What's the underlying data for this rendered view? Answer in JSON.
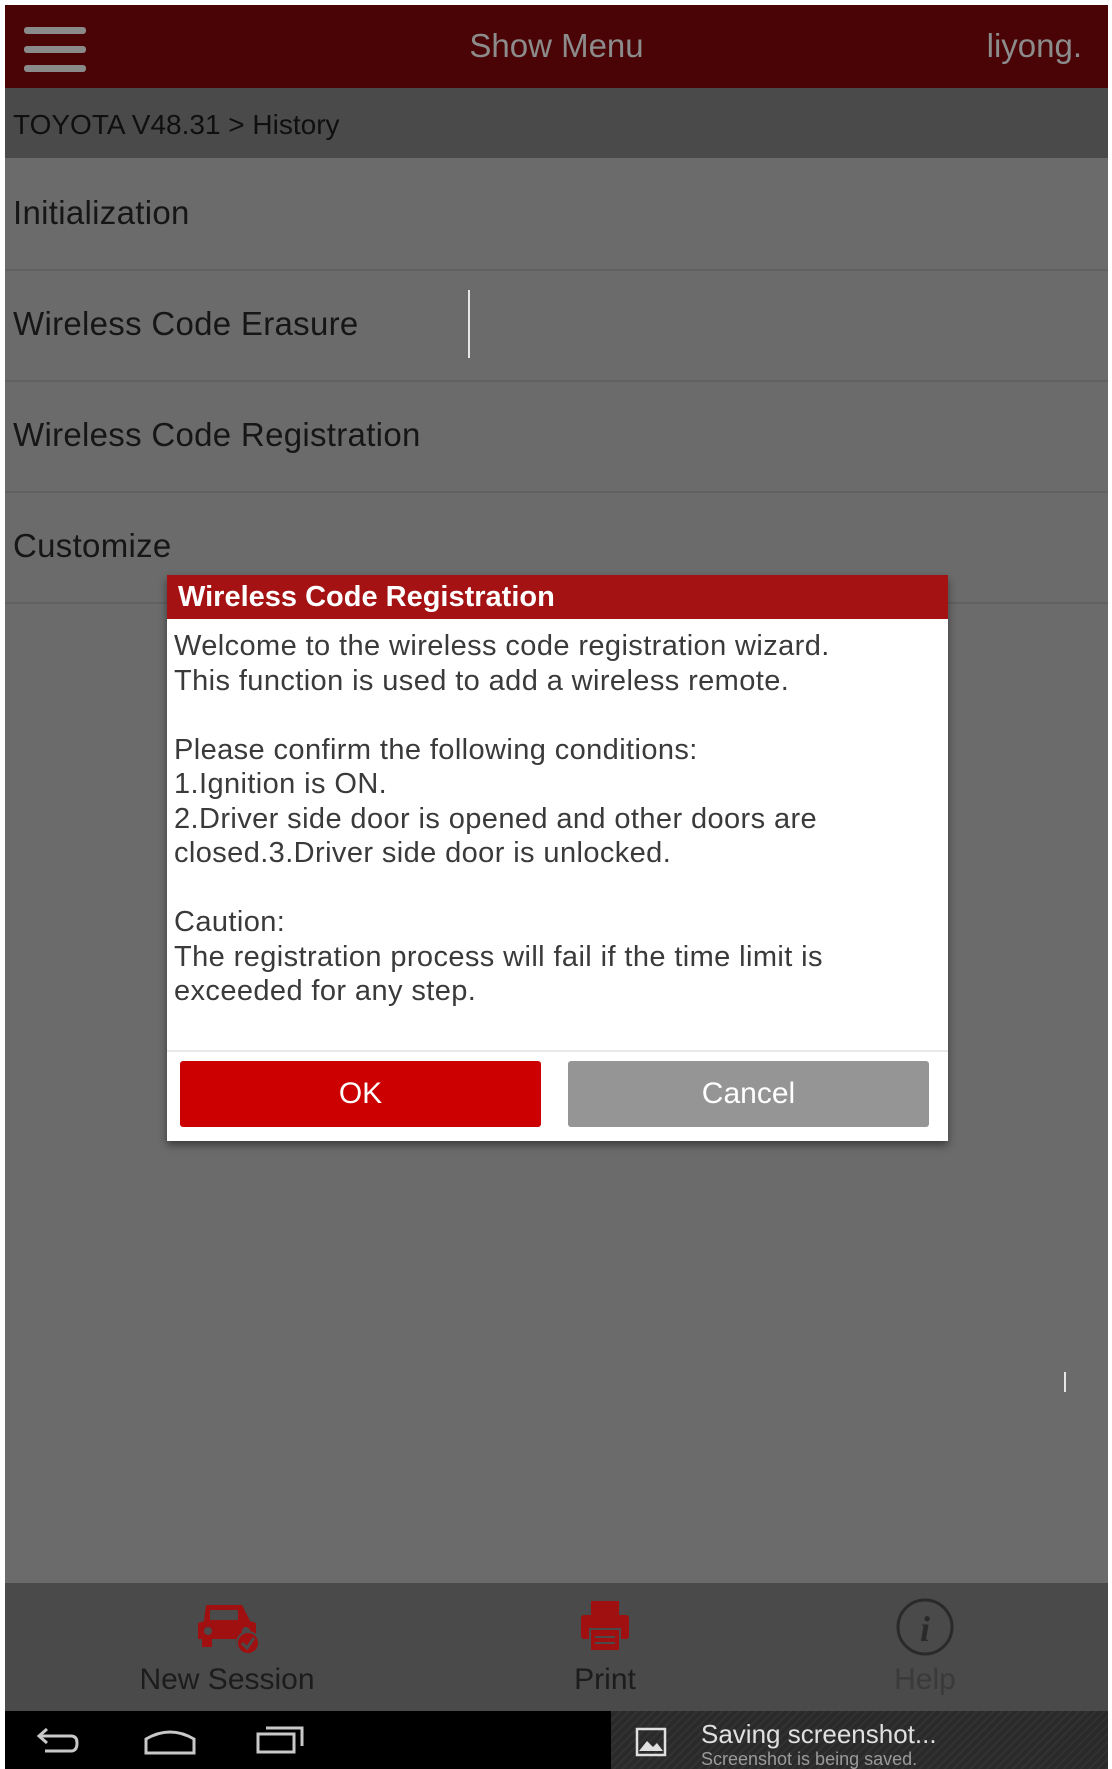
{
  "header": {
    "title": "Show Menu",
    "user": "liyong."
  },
  "breadcrumb": "TOYOTA V48.31 > History",
  "menu_items": [
    {
      "label": "Initialization"
    },
    {
      "label": "Wireless Code Erasure"
    },
    {
      "label": "Wireless Code Registration"
    },
    {
      "label": "Customize"
    }
  ],
  "dialog": {
    "title": "Wireless Code Registration",
    "lines": [
      "Welcome to the wireless code registration wizard.",
      "This function is used to add a wireless remote.",
      "",
      "Please confirm the following conditions:",
      "1.Ignition is ON.",
      "2.Driver side door is opened and other doors are",
      "closed.3.Driver side door is unlocked.",
      "",
      "Caution:",
      "The registration process will fail if the time limit is",
      "exceeded for any step."
    ],
    "ok_label": "OK",
    "cancel_label": "Cancel"
  },
  "bottom_bar": {
    "new_session": "New Session",
    "print": "Print",
    "help": "Help"
  },
  "notification": {
    "title": "Saving screenshot...",
    "subtitle": "Screenshot is being saved."
  },
  "colors": {
    "header_bg": "#4a0405",
    "accent_red": "#cc0000",
    "dialog_header": "#a41214",
    "overlay_gray": "#6b6b6b"
  },
  "icons": [
    "menu-icon",
    "car-icon",
    "print-icon",
    "info-icon",
    "back-icon",
    "home-icon",
    "recent-apps-icon",
    "image-icon"
  ]
}
